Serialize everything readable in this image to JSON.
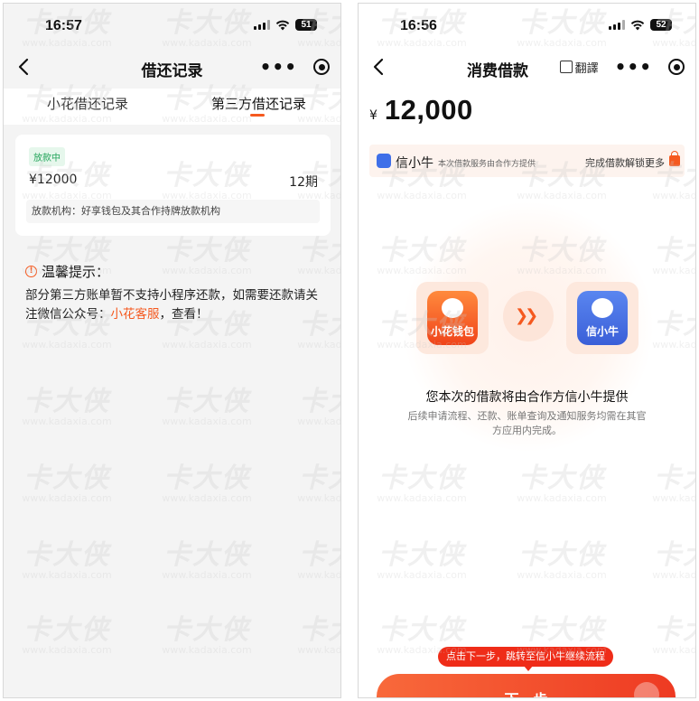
{
  "watermark": {
    "main": "卡大侠",
    "sub": "www.kadaxia.com"
  },
  "left": {
    "status": {
      "time": "16:57",
      "battery": "51"
    },
    "nav": {
      "title": "借还记录"
    },
    "tabs": [
      {
        "label": "小花借还记录",
        "active": false
      },
      {
        "label": "第三方借还记录",
        "active": true
      }
    ],
    "record": {
      "status": "放款中",
      "amount": "¥12000",
      "period": "12期",
      "agency": "放款机构：好享钱包及其合作持牌放款机构"
    },
    "tips": {
      "title": "温馨提示：",
      "body": "部分第三方账单暂不支持小程序还款，如需要还款请关注微信公众号：",
      "link": "小花客服",
      "suffix": "，查看！"
    }
  },
  "right": {
    "status": {
      "time": "16:56",
      "battery": "52"
    },
    "nav": {
      "title": "消费借款",
      "translate": "翻譯"
    },
    "amount": {
      "currency": "¥",
      "value": "12,000"
    },
    "provider": {
      "name": "信小牛",
      "note": "本次借款服务由合作方提供",
      "unlock": "完成借款解锁更多"
    },
    "apps": {
      "from_label": "小花钱包",
      "to_label": "信小牛"
    },
    "notice": {
      "title": "您本次的借款将由合作方信小牛提供",
      "subtitle": "后续申请流程、还款、账单查询及通知服务均需在其官方应用内完成。"
    },
    "tooltip": "点击下一步，跳转至信小牛继续流程",
    "next_button": "下一步"
  }
}
